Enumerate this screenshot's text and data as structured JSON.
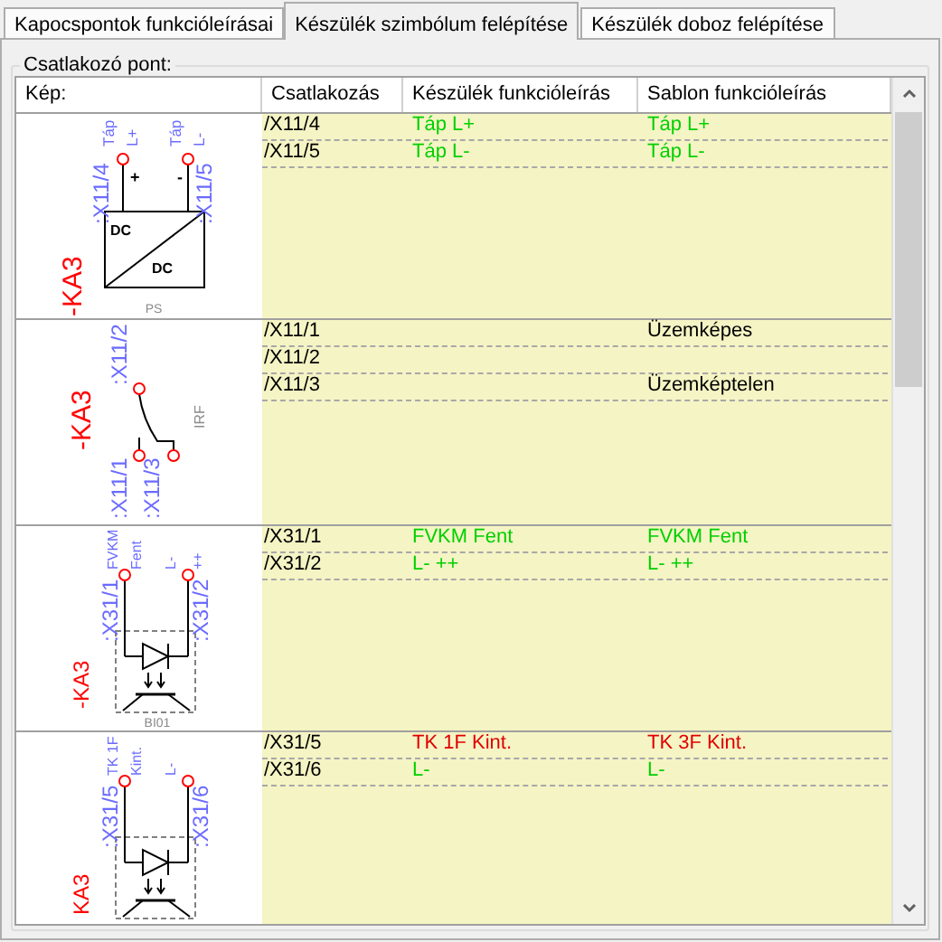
{
  "tabs": [
    {
      "label": "Kapocspontok funkcióleírásai",
      "selected": false
    },
    {
      "label": "Készülék szimbólum felépítése",
      "selected": true
    },
    {
      "label": "Készülék doboz felépítése",
      "selected": false
    }
  ],
  "group": {
    "title": "Csatlakozó pont:"
  },
  "table": {
    "columns": [
      "Kép:",
      "Csatlakozás",
      "Készülék funkcióleírás",
      "Sablon funkcióleírás"
    ],
    "rows": [
      {
        "symbol": {
          "kind": "power_supply",
          "device": "-KA3",
          "type_label": "PS",
          "texts": [
            "DC",
            "DC"
          ],
          "pins": [
            {
              "terminal": ":X11/4",
              "label_lines": [
                "Táp",
                "L+"
              ],
              "sign": "+"
            },
            {
              "terminal": ":X11/5",
              "label_lines": [
                "Táp",
                "L-"
              ],
              "sign": "-"
            }
          ]
        },
        "connections": [
          {
            "terminal": "/X11/4",
            "device_function": {
              "text": "Táp L+",
              "color": "#00d000"
            },
            "template_function": {
              "text": "Táp L+",
              "color": "#00d000"
            }
          },
          {
            "terminal": "/X11/5",
            "device_function": {
              "text": "Táp L-",
              "color": "#00d000"
            },
            "template_function": {
              "text": "Táp L-",
              "color": "#00d000"
            }
          }
        ]
      },
      {
        "symbol": {
          "kind": "switch",
          "device": "-KA3",
          "type_label": "IRF",
          "pins": [
            {
              "terminal": ":X11/2"
            },
            {
              "terminal": ":X11/1"
            },
            {
              "terminal": ":X11/3"
            }
          ]
        },
        "connections": [
          {
            "terminal": "/X11/1",
            "template_function": {
              "text": "Üzemképes",
              "color": "#000000"
            }
          },
          {
            "terminal": "/X11/2"
          },
          {
            "terminal": "/X11/3",
            "template_function": {
              "text": "Üzemképtelen",
              "color": "#000000"
            }
          }
        ]
      },
      {
        "symbol": {
          "kind": "optocoupler",
          "device": "-KA3",
          "type_label": "BI01",
          "pins": [
            {
              "terminal": ":X31/1",
              "label_lines": [
                "FVKM",
                "Fent"
              ]
            },
            {
              "terminal": ":X31/2",
              "label_lines": [
                "L-",
                "++"
              ]
            }
          ]
        },
        "connections": [
          {
            "terminal": "/X31/1",
            "device_function": {
              "text": "FVKM Fent",
              "color": "#00d000"
            },
            "template_function": {
              "text": "FVKM Fent",
              "color": "#00d000"
            }
          },
          {
            "terminal": "/X31/2",
            "device_function": {
              "text": "L- ++",
              "color": "#00d000"
            },
            "template_function": {
              "text": "L- ++",
              "color": "#00d000"
            }
          }
        ]
      },
      {
        "symbol": {
          "kind": "optocoupler",
          "device": "KA3",
          "pins": [
            {
              "terminal": ":X31/5",
              "label_lines": [
                "TK 1F",
                "Kint."
              ]
            },
            {
              "terminal": ":X31/6",
              "label_lines": [
                "L-"
              ]
            }
          ]
        },
        "connections": [
          {
            "terminal": "/X31/5",
            "device_function": {
              "text": "TK 1F Kint.",
              "color": "#e00000"
            },
            "template_function": {
              "text": "TK 3F Kint.",
              "color": "#e00000"
            }
          },
          {
            "terminal": "/X31/6",
            "device_function": {
              "text": "L-",
              "color": "#00d000"
            },
            "template_function": {
              "text": "L-",
              "color": "#00d000"
            }
          }
        ]
      }
    ]
  }
}
